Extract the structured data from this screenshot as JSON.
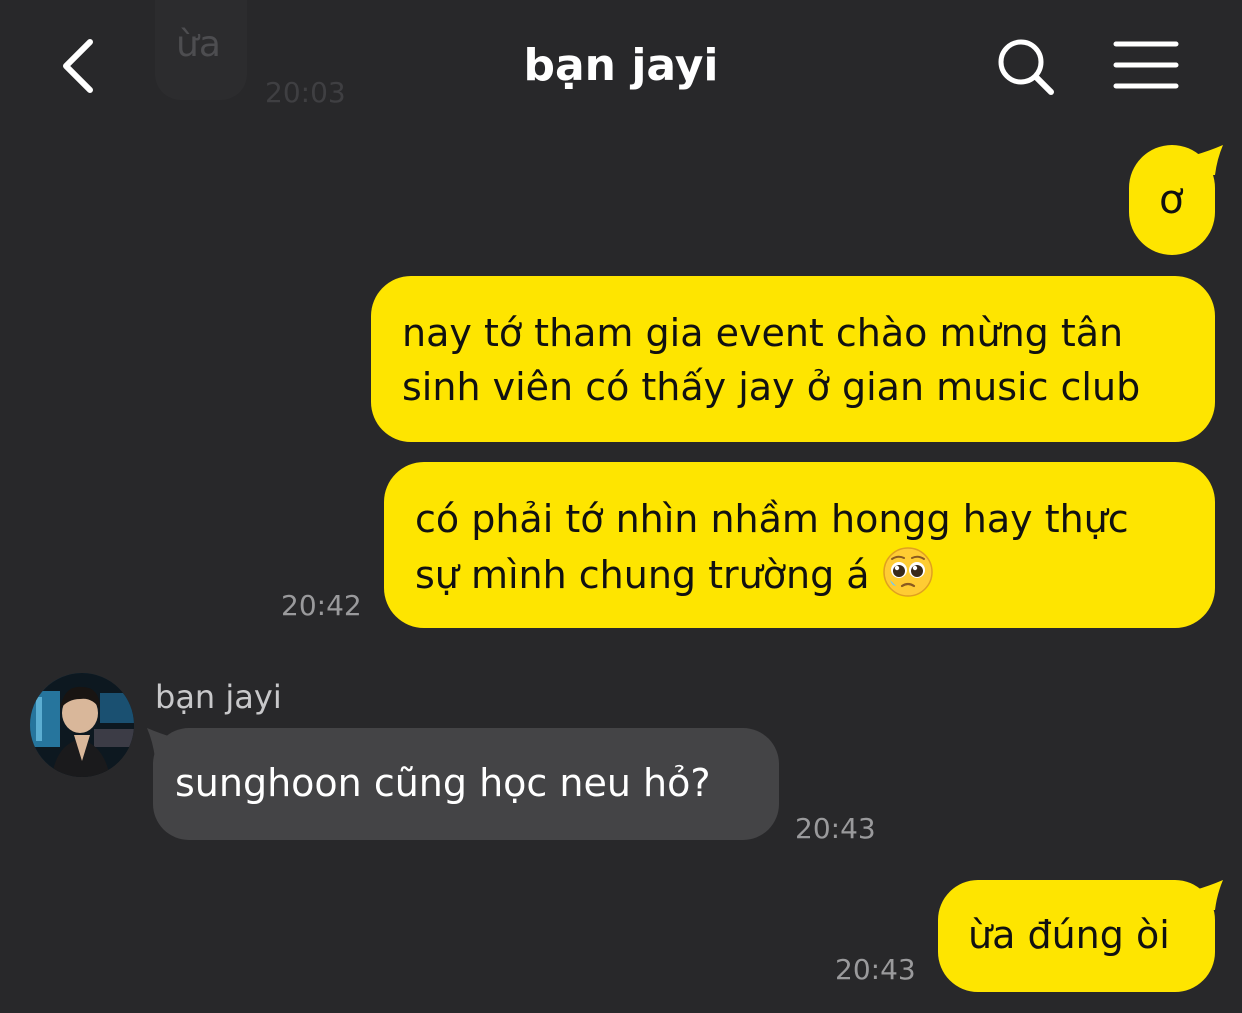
{
  "header": {
    "title": "bạn jayi",
    "back_icon": "chevron-left-icon",
    "search_icon": "search-icon",
    "menu_icon": "menu-icon"
  },
  "ghost": {
    "text": "ừa",
    "time": "20:03"
  },
  "messages": [
    {
      "direction": "out",
      "text": "ơ"
    },
    {
      "direction": "out",
      "lines": [
        "nay tớ tham gia event chào mừng tân",
        "sinh viên có thấy jay ở gian music club"
      ]
    },
    {
      "direction": "out",
      "lines": [
        "có phải tớ nhìn nhầm hongg hay thực",
        "sự mình chung trường á"
      ],
      "emoji": "pleading-face-emoji",
      "time": "20:42"
    },
    {
      "direction": "in",
      "sender": "bạn jayi",
      "text": "sunghoon cũng học neu hỏ?",
      "time": "20:43"
    },
    {
      "direction": "out",
      "text": "ừa đúng òi",
      "time": "20:43"
    }
  ],
  "colors": {
    "background": "#28282a",
    "outgoing_bubble": "#fee500",
    "incoming_bubble": "#444446",
    "timestamp": "#9a9a9c"
  }
}
